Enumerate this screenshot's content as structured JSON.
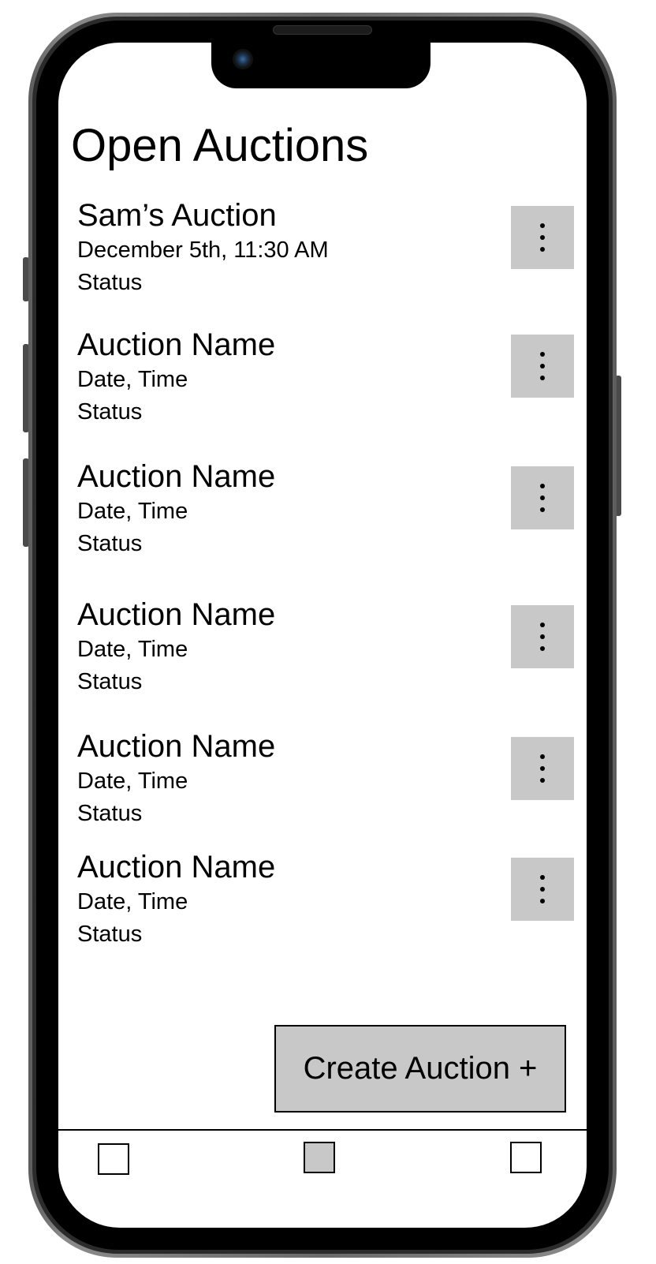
{
  "page": {
    "title": "Open Auctions"
  },
  "auctions": [
    {
      "name": "Sam’s Auction",
      "datetime": "December 5th, 11:30 AM",
      "status": "Status"
    },
    {
      "name": "Auction Name",
      "datetime": "Date, Time",
      "status": "Status"
    },
    {
      "name": "Auction Name",
      "datetime": "Date, Time",
      "status": "Status"
    },
    {
      "name": "Auction Name",
      "datetime": "Date, Time",
      "status": "Status"
    },
    {
      "name": "Auction Name",
      "datetime": "Date, Time",
      "status": "Status"
    },
    {
      "name": "Auction Name",
      "datetime": "Date, Time",
      "status": "Status"
    }
  ],
  "actions": {
    "create_label": "Create Auction +"
  },
  "icons": {
    "more": "more-vertical-icon"
  },
  "bottom_nav": {
    "tabs": [
      {
        "name": "tab-1",
        "active": false
      },
      {
        "name": "tab-2",
        "active": true
      },
      {
        "name": "tab-3",
        "active": false
      }
    ]
  },
  "colors": {
    "button_fill": "#c8c8c8",
    "text": "#000000",
    "screen_background": "#ffffff"
  }
}
